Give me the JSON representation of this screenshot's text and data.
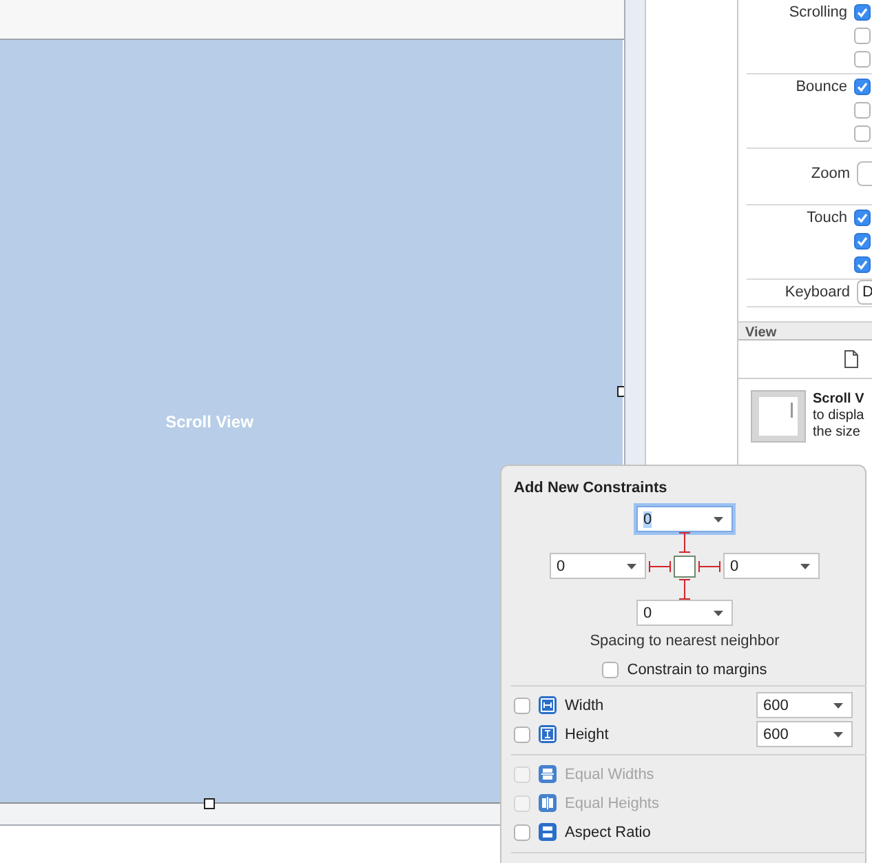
{
  "canvas": {
    "scroll_view_label": "Scroll View"
  },
  "inspector": {
    "groups": [
      {
        "kind": "checkboxes",
        "label": "Scrolling",
        "boxes": [
          {
            "checked": true
          },
          {
            "checked": false
          },
          {
            "checked": false
          }
        ]
      },
      {
        "kind": "checkboxes",
        "label": "Bounce",
        "boxes": [
          {
            "checked": true
          },
          {
            "checked": false
          },
          {
            "checked": false
          }
        ]
      },
      {
        "kind": "field",
        "label": "Zoom"
      },
      {
        "kind": "checkboxes",
        "label": "Touch",
        "boxes": [
          {
            "checked": true
          },
          {
            "checked": true
          },
          {
            "checked": true
          }
        ]
      },
      {
        "kind": "popup",
        "label": "Keyboard",
        "value": "D"
      }
    ],
    "library": {
      "section_title": "View",
      "item": {
        "title": "Scroll V",
        "description_lines": [
          "to displa",
          "the size"
        ]
      }
    }
  },
  "popover": {
    "title": "Add New Constraints",
    "spacing": {
      "top": {
        "value": "0",
        "focused": true
      },
      "left": {
        "value": "0",
        "focused": false
      },
      "right": {
        "value": "0",
        "focused": false
      },
      "bottom": {
        "value": "0",
        "focused": false
      }
    },
    "caption": "Spacing to nearest neighbor",
    "constrain_to_margins": {
      "label": "Constrain to margins",
      "checked": false
    },
    "size_rows": [
      {
        "label": "Width",
        "checked": false,
        "value": "600"
      },
      {
        "label": "Height",
        "checked": false,
        "value": "600"
      }
    ],
    "relation_rows": [
      {
        "label": "Equal Widths",
        "checked": false,
        "disabled": true
      },
      {
        "label": "Equal Heights",
        "checked": false,
        "disabled": true
      },
      {
        "label": "Aspect Ratio",
        "checked": false,
        "disabled": false
      }
    ]
  }
}
